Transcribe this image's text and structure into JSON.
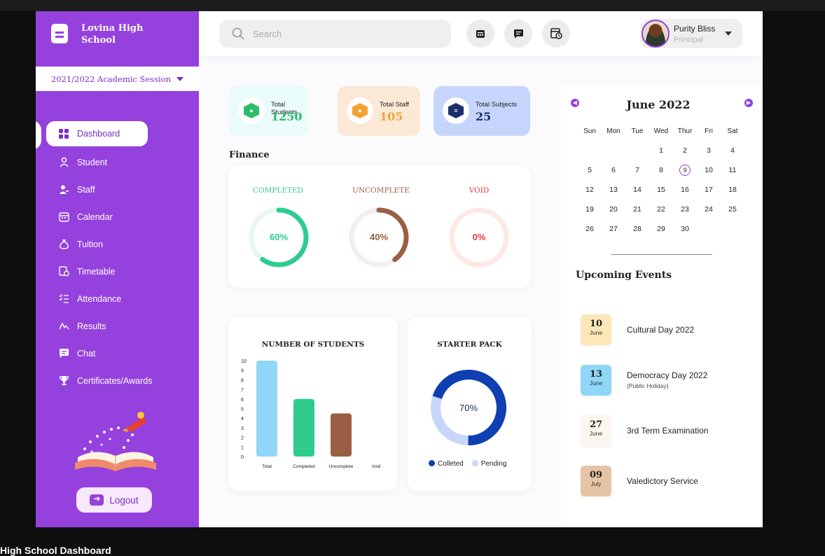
{
  "colors": {
    "brand": "#9541dd",
    "completed": "#2ecc8f",
    "uncomplete": "#9a5e44",
    "void": "#e23b3b",
    "pack_collected": "#0f3fb0",
    "pack_pending": "#c9d6fb"
  },
  "school": {
    "name": "Lovina High School",
    "session": "2021/2022 Academic Session"
  },
  "sidebar": {
    "items": [
      {
        "label": "Dashboard",
        "icon": "grid-icon"
      },
      {
        "label": "Student",
        "icon": "users-icon"
      },
      {
        "label": "Staff",
        "icon": "staff-icon"
      },
      {
        "label": "Calendar",
        "icon": "calendar-icon"
      },
      {
        "label": "Tuition",
        "icon": "money-bag-icon"
      },
      {
        "label": "Timetable",
        "icon": "timetable-icon"
      },
      {
        "label": "Attendance",
        "icon": "checklist-icon"
      },
      {
        "label": "Results",
        "icon": "results-icon"
      },
      {
        "label": "Chat",
        "icon": "chat-icon"
      },
      {
        "label": "Certificates/Awards",
        "icon": "trophy-icon"
      }
    ],
    "logout": "Logout"
  },
  "header": {
    "search_placeholder": "Search",
    "user": {
      "name": "Purity Bliss",
      "role": "Principal"
    }
  },
  "stats": [
    {
      "label": "Total Students",
      "value": "1250",
      "bg": "#eafbfb",
      "iconbg": "#2ebc6b",
      "valcolor": "#2ebc6b"
    },
    {
      "label": "Total Staff",
      "value": "105",
      "bg": "#fbe9d6",
      "iconbg": "#f2a233",
      "valcolor": "#f2a233"
    },
    {
      "label": "Total Subjects",
      "value": "25",
      "bg": "#c6d5fb",
      "iconbg": "#1b2f6b",
      "valcolor": "#1b2f6b"
    }
  ],
  "finance": {
    "title": "Finance",
    "rings": [
      {
        "label": "COMPLETED",
        "value": 60,
        "text": "60%"
      },
      {
        "label": "UNCOMPLETE",
        "value": 40,
        "text": "40%"
      },
      {
        "label": "VOID",
        "value": 0,
        "text": "0%"
      }
    ]
  },
  "students_chart": {
    "title": "NUMBER OF STUDENTS"
  },
  "chart_data": {
    "type": "bar",
    "title": "NUMBER OF STUDENTS",
    "categories": [
      "Total",
      "Completed",
      "Uncomplete",
      "Void"
    ],
    "values": [
      10,
      6,
      4.5,
      0
    ],
    "colors": [
      "#8fd6f7",
      "#2ecc8f",
      "#9a5e44",
      "#cccccc"
    ],
    "ylim": [
      0,
      10
    ],
    "yticks": [
      0,
      1,
      2,
      3,
      4,
      5,
      6,
      7,
      8,
      9,
      10
    ],
    "grid": false
  },
  "starter_pack": {
    "title": "STARTER PACK",
    "value": 70,
    "text": "70%",
    "legend": [
      "Colleted",
      "Pending"
    ]
  },
  "calendar": {
    "title": "June 2022",
    "dow": [
      "Sun",
      "Mon",
      "Tue",
      "Wed",
      "Thur",
      "Fri",
      "Sat"
    ],
    "start_offset": 3,
    "days": 30,
    "today": 9
  },
  "events": {
    "title": "Upcoming Events",
    "items": [
      {
        "day": "10",
        "month": "June",
        "name": "Cultural Day 2022",
        "sub": "",
        "bg": "#fbe7b8"
      },
      {
        "day": "13",
        "month": "June",
        "name": "Democracy Day 2022",
        "sub": "(Public Holiday)",
        "bg": "#8fd6f7"
      },
      {
        "day": "27",
        "month": "June",
        "name": "3rd Term Examination",
        "sub": "",
        "bg": "#fdf6ee"
      },
      {
        "day": "09",
        "month": "July",
        "name": "Valedictory Service",
        "sub": "",
        "bg": "#e5c4a5"
      }
    ]
  },
  "page_caption": "High School Dashboard"
}
